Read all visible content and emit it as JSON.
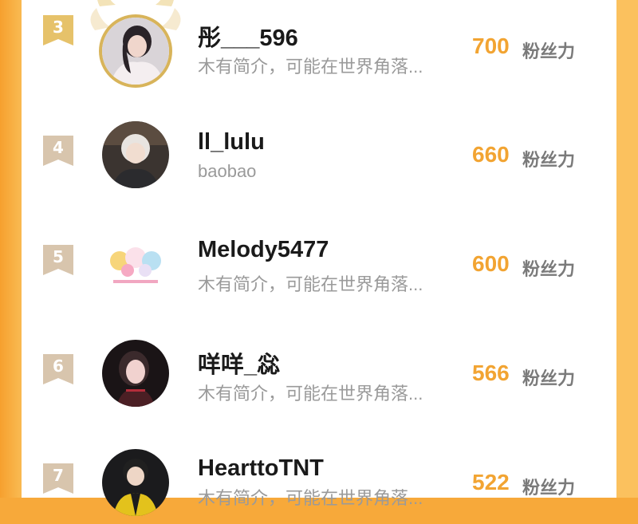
{
  "colors": {
    "frame": "#f7a93a",
    "score": "#f2a432",
    "badge_top3": "#e6c26a",
    "badge_other": "#d8c5ad",
    "name": "#1a1a1a",
    "bio": "#9a9a9a",
    "score_label": "#7a7a7a"
  },
  "score_unit": "粉丝力",
  "ranking": [
    {
      "rank": "3",
      "name": "彤___596",
      "bio": "木有简介，可能在世界角落...",
      "score": "700",
      "badge": "gold-ribbon",
      "crown": true
    },
    {
      "rank": "4",
      "name": "ll_lulu",
      "bio": "baobao",
      "score": "660",
      "badge": "ribbon",
      "crown": false
    },
    {
      "rank": "5",
      "name": "Melody5477",
      "bio": "木有简介，可能在世界角落...",
      "score": "600",
      "badge": "ribbon",
      "crown": false
    },
    {
      "rank": "6",
      "name": "咩咩_惢",
      "bio": "木有简介，可能在世界角落...",
      "score": "566",
      "badge": "ribbon",
      "crown": false
    },
    {
      "rank": "7",
      "name": "HearttoTNT",
      "bio": "木有简介，可能在世界角落...",
      "score": "522",
      "badge": "ribbon",
      "crown": false
    }
  ]
}
